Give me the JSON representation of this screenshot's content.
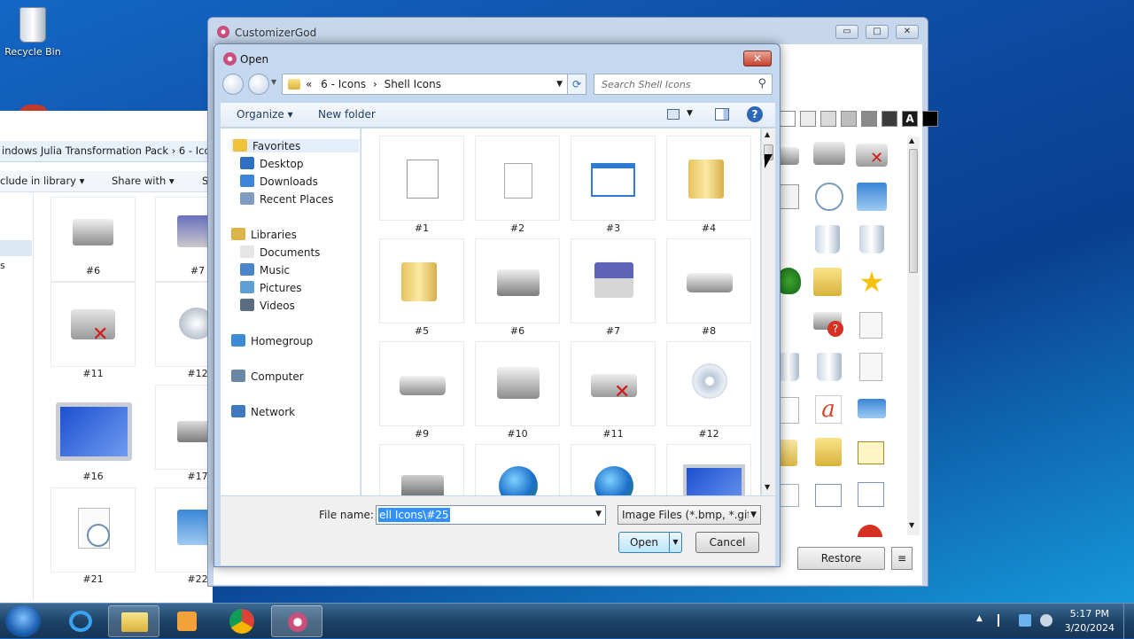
{
  "desktop": {
    "recycle_bin": "Recycle Bin"
  },
  "explorer": {
    "breadcrumb": "indows Julia Transformation Pack  ›  6 - Ico",
    "toolbar": {
      "include": "clude in library ▾",
      "share": "Share with ▾",
      "more": "S"
    },
    "nav_fragment": "s",
    "items": [
      {
        "label": "#6"
      },
      {
        "label": "#7"
      },
      {
        "label": "#11"
      },
      {
        "label": "#12"
      },
      {
        "label": "#16"
      },
      {
        "label": "#17"
      },
      {
        "label": "#21"
      },
      {
        "label": "#22"
      }
    ]
  },
  "customizer": {
    "title": "CustomizerGod",
    "controls": {
      "min": "▭",
      "max": "□",
      "close": "✕"
    },
    "swatch_letter": "A",
    "swatch_colors": [
      "#ffffff",
      "#ececec",
      "#dadada",
      "#bebebe",
      "#8a8a8a",
      "#3c3c3c",
      "#1a1a1a",
      "#000000"
    ],
    "restore_label": "Restore",
    "menu_glyph": "≡"
  },
  "dialog": {
    "title": "Open",
    "close_glyph": "✕",
    "address": {
      "prefix": "«",
      "path": [
        "6 - Icons",
        "Shell Icons"
      ]
    },
    "search_placeholder": "Search Shell Icons",
    "toolbar": {
      "organize": "Organize ▾",
      "new_folder": "New folder",
      "help": "?"
    },
    "nav": [
      {
        "label": "Favorites",
        "color": "#f0c23a"
      },
      {
        "label": "Desktop",
        "color": "#2f6fc2"
      },
      {
        "label": "Downloads",
        "color": "#3e84d8"
      },
      {
        "label": "Recent Places",
        "color": "#7e9cbf"
      },
      {
        "label": "Libraries",
        "color": "#d9b54a"
      },
      {
        "label": "Documents",
        "color": "#e6e6e6"
      },
      {
        "label": "Music",
        "color": "#4a84c9"
      },
      {
        "label": "Pictures",
        "color": "#5ea0d4"
      },
      {
        "label": "Videos",
        "color": "#5b6d80"
      },
      {
        "label": "Homegroup",
        "color": "#3d8bd3"
      },
      {
        "label": "Computer",
        "color": "#6b87a6"
      },
      {
        "label": "Network",
        "color": "#3f79c0"
      }
    ],
    "items": [
      {
        "label": "#1",
        "icon": "window-grid-icon"
      },
      {
        "label": "#2",
        "icon": "document-icon"
      },
      {
        "label": "#3",
        "icon": "window-icon"
      },
      {
        "label": "#4",
        "icon": "folder-icon"
      },
      {
        "label": "#5",
        "icon": "folder-icon"
      },
      {
        "label": "#6",
        "icon": "locked-drive-icon"
      },
      {
        "label": "#7",
        "icon": "floppy-drive-icon"
      },
      {
        "label": "#8",
        "icon": "drive-icon"
      },
      {
        "label": "#9",
        "icon": "drive-icon"
      },
      {
        "label": "#10",
        "icon": "network-drive-icon"
      },
      {
        "label": "#11",
        "icon": "disconnected-drive-icon"
      },
      {
        "label": "#12",
        "icon": "cd-drive-icon"
      },
      {
        "label": "",
        "icon": "chip-icon"
      },
      {
        "label": "",
        "icon": "globe-icon"
      },
      {
        "label": "",
        "icon": "globe-icon"
      },
      {
        "label": "",
        "icon": "monitor-icon"
      }
    ],
    "file_name_label": "File name:",
    "file_name_value": "ell Icons\\#25",
    "file_type": "Image Files (*.bmp, *.gif,",
    "open_label": "Open",
    "cancel_label": "Cancel"
  },
  "taskbar": {
    "time": "5:17 PM",
    "date": "3/20/2024"
  }
}
